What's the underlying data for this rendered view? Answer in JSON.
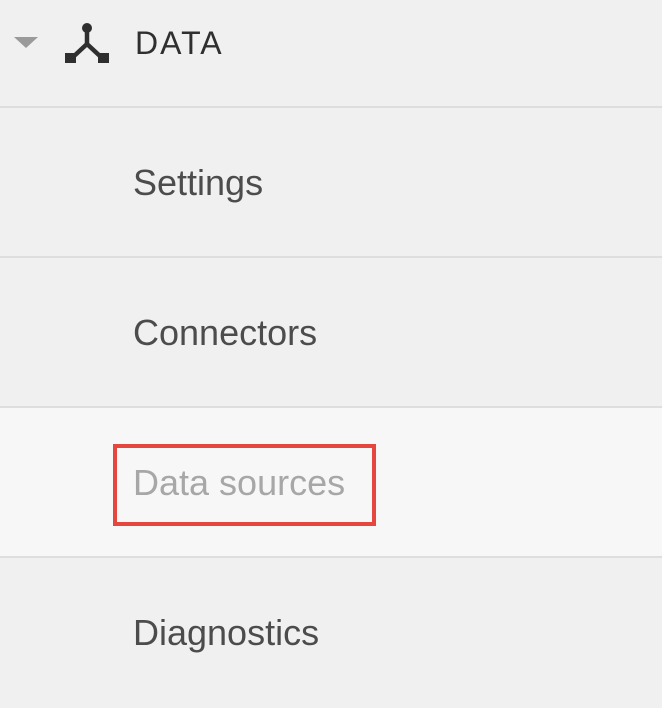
{
  "section": {
    "title": "DATA",
    "expand_icon": "caret-down-icon",
    "icon": "data-pipeline-icon"
  },
  "nav_items": [
    {
      "label": "Settings",
      "selected": false
    },
    {
      "label": "Connectors",
      "selected": false
    },
    {
      "label": "Data sources",
      "selected": true
    },
    {
      "label": "Diagnostics",
      "selected": false
    }
  ],
  "colors": {
    "highlight": "#e5473f",
    "text": "#4c4c4c",
    "selected_text": "#a7a7a7",
    "background": "#f0f0f0",
    "selected_background": "#f7f7f7",
    "divider": "#dedede"
  }
}
